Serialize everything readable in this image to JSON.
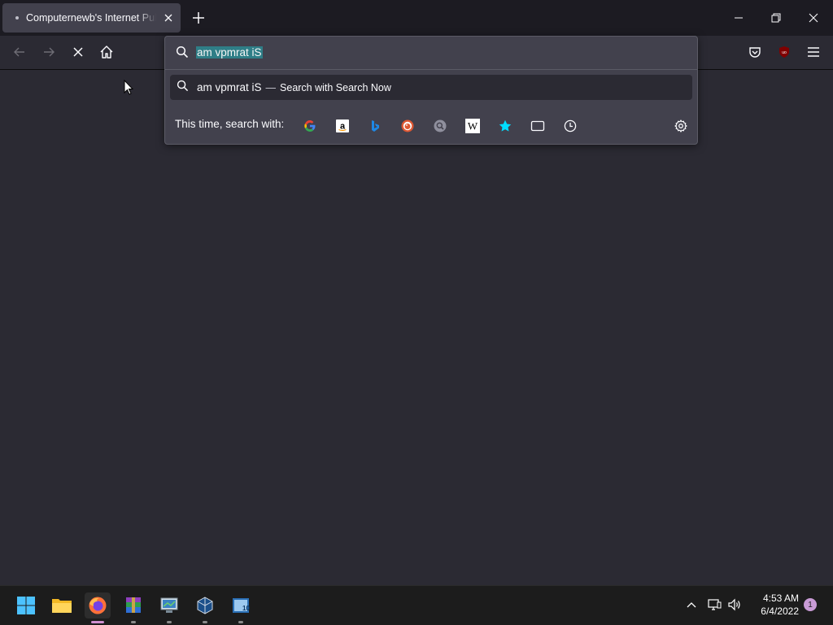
{
  "tab": {
    "title": "Computernewb's Internet Pub Hub",
    "loading_dot": "•"
  },
  "window_controls": [
    "minimize",
    "restore",
    "close"
  ],
  "nav": {
    "back": "back-icon",
    "forward": "forward-icon",
    "stop": "stop-icon",
    "home": "home-icon"
  },
  "urlbar": {
    "value": "am vpmrat iS",
    "suggestion": {
      "query": "am vpmrat iS",
      "dash": "—",
      "action": "Search with Search Now"
    },
    "one_off_label": "This time, search with:",
    "engines": [
      "google",
      "amazon",
      "bing",
      "duckduckgo",
      "search-now",
      "wikipedia",
      "bookmarks",
      "tabs",
      "history"
    ]
  },
  "toolbar_right": [
    "pocket-icon",
    "ublock-icon",
    "menu-icon"
  ],
  "taskbar": {
    "apps": [
      "start",
      "file-explorer",
      "firefox",
      "winrar",
      "remote-desktop",
      "virtualbox",
      "cpu-z"
    ],
    "clock": {
      "time": "4:53 AM",
      "date": "6/4/2022"
    },
    "notifications": "1"
  },
  "colors": {
    "accent": "#2f7e87",
    "background": "#2b2a33",
    "panel": "#42414d"
  }
}
